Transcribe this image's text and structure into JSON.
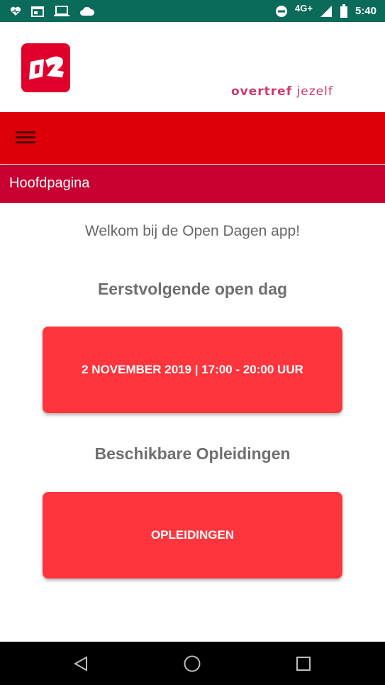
{
  "status_bar": {
    "network": "4G+",
    "time": "5:40",
    "icons": [
      "heart-pulse-icon",
      "calendar-icon",
      "laptop-icon",
      "cloud-icon",
      "do-not-disturb-icon",
      "signal-icon",
      "battery-icon"
    ]
  },
  "brand": {
    "tagline_bold": "overtref",
    "tagline_light": "jezelf",
    "logo_color": "#e0002b"
  },
  "toolbar": {
    "menu_icon": "hamburger-menu-icon",
    "color": "#de0009"
  },
  "page": {
    "title": "Hoofdpagina"
  },
  "content": {
    "welcome": "Welkom bij de Open Dagen app!",
    "next_open_day_heading": "Eerstvolgende open dag",
    "next_open_day_button": "2 NOVEMBER 2019 | 17:00 - 20:00 UUR",
    "programs_heading": "Beschikbare Opleidingen",
    "programs_button": "OPLEIDINGEN",
    "button_color": "#ff353d"
  },
  "nav_bar": {
    "back": "back-triangle-icon",
    "home": "home-circle-icon",
    "recents": "recents-square-icon"
  }
}
